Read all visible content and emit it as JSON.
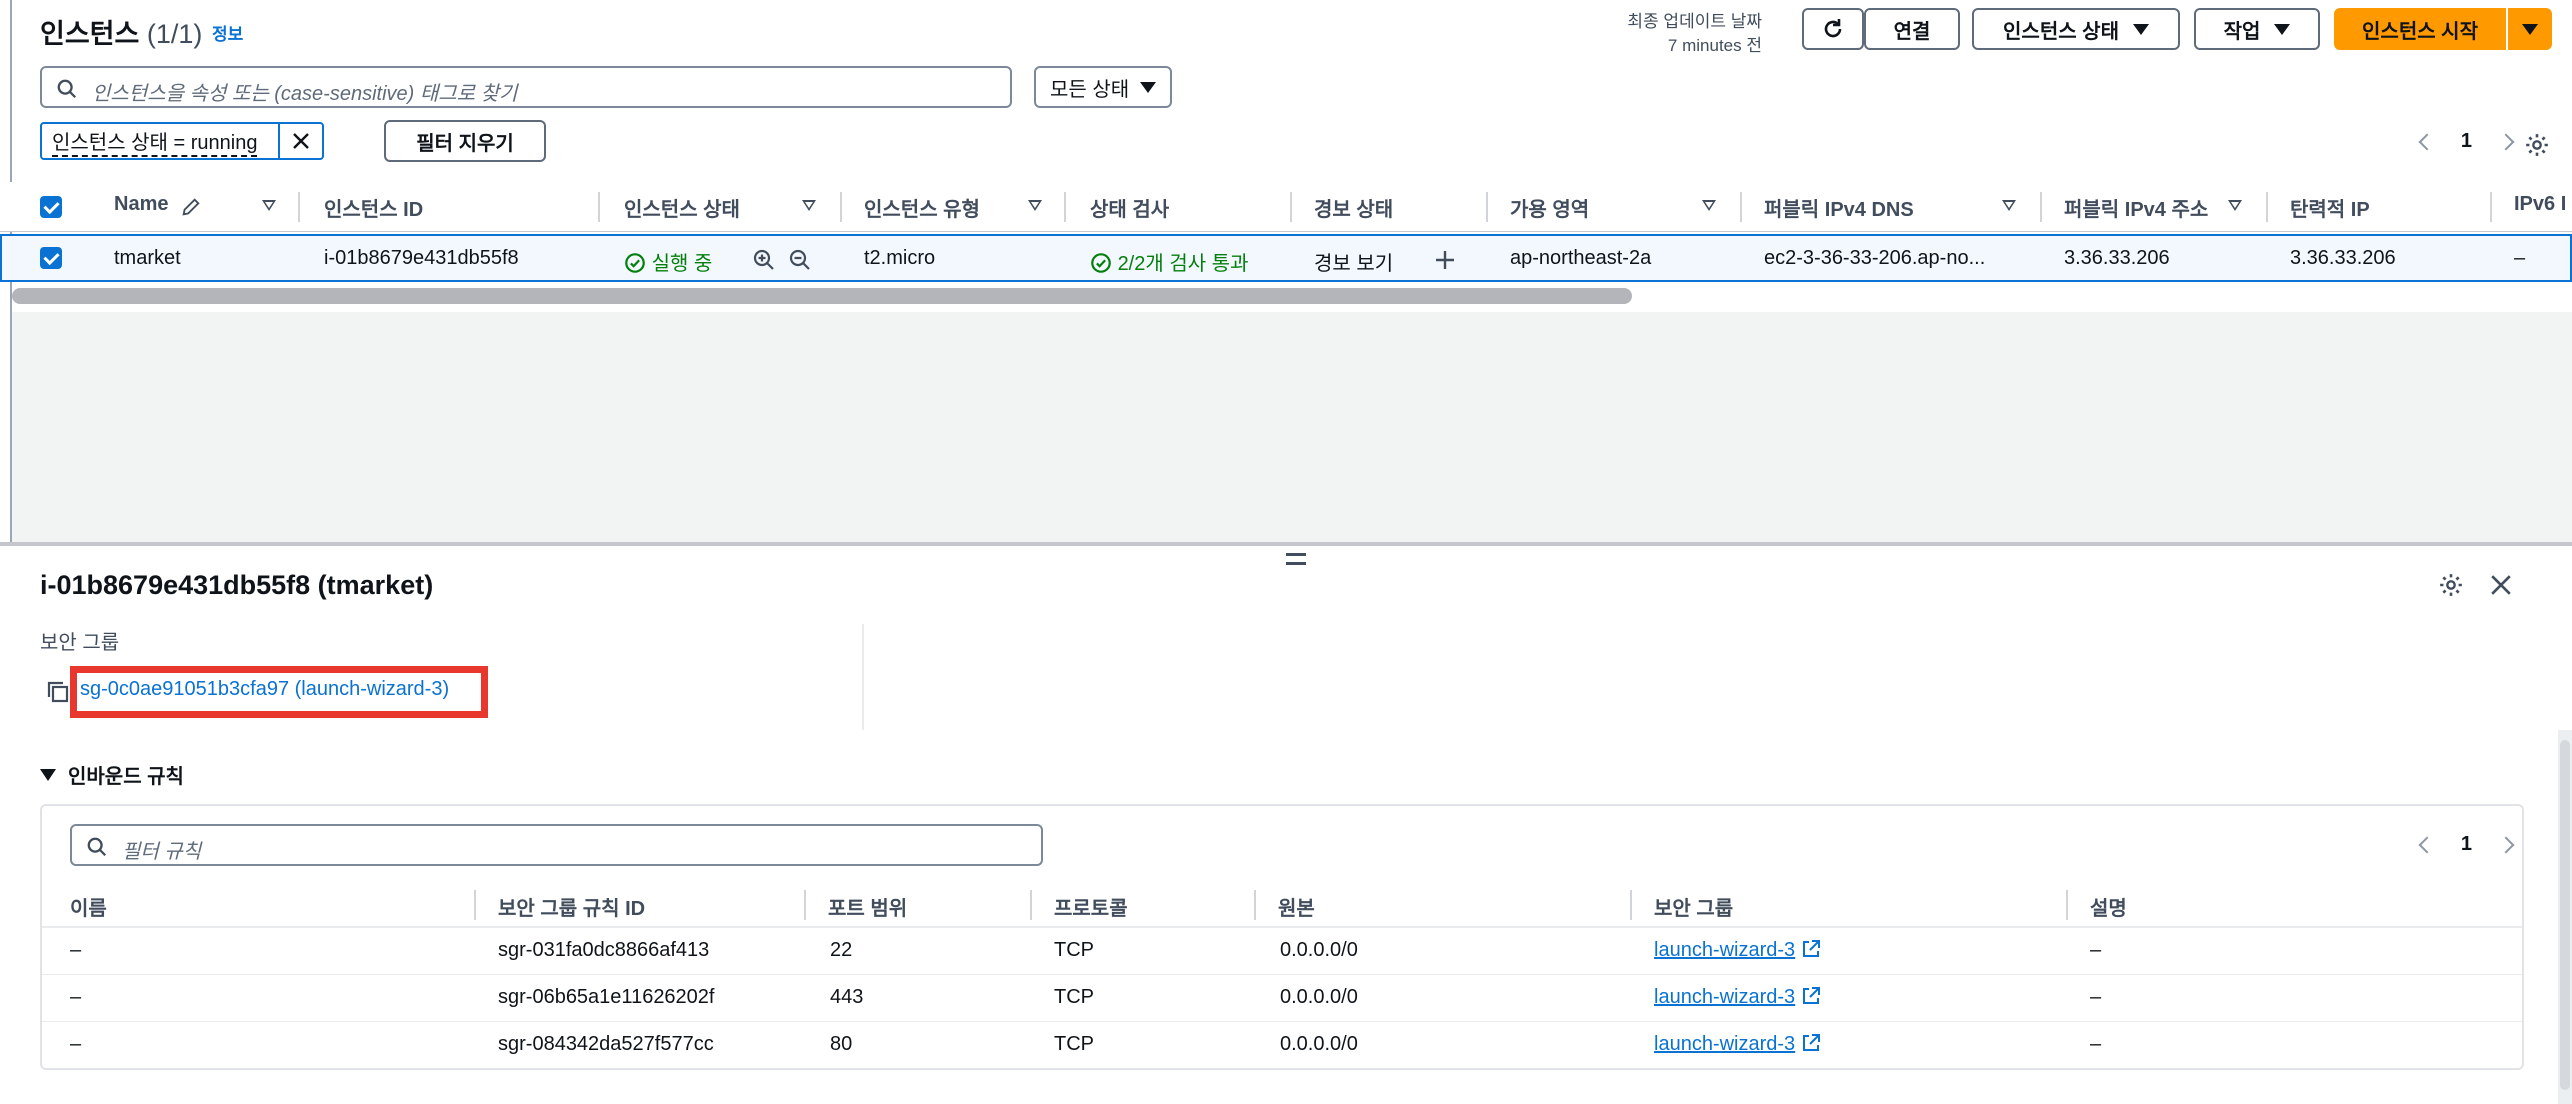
{
  "header": {
    "title": "인스턴스",
    "count": "(1/1)",
    "info": "정보",
    "last_updated_label": "최종 업데이트 날짜",
    "last_updated_value": "7 minutes 전",
    "connect_label": "연결",
    "instance_state_label": "인스턴스 상태",
    "actions_label": "작업",
    "launch_label": "인스턴스 시작"
  },
  "search": {
    "placeholder": "인스턴스을 속성 또는 (case-sensitive) 태그로 찾기",
    "state_filter": "모든 상태"
  },
  "filter": {
    "token": "인스턴스 상태 = running",
    "clear_label": "필터 지우기"
  },
  "pagination": {
    "page": "1"
  },
  "table": {
    "columns": [
      "Name",
      "인스턴스 ID",
      "인스턴스 상태",
      "인스턴스 유형",
      "상태 검사",
      "경보 상태",
      "가용 영역",
      "퍼블릭 IPv4 DNS",
      "퍼블릭 IPv4 주소",
      "탄력적 IP",
      "IPv6 I"
    ],
    "row": {
      "name": "tmarket",
      "instance_id": "i-01b8679e431db55f8",
      "state": "실행 중",
      "type": "t2.micro",
      "status_check": "2/2개 검사 통과",
      "alarm": "경보 보기",
      "az": "ap-northeast-2a",
      "dns": "ec2-3-36-33-206.ap-no...",
      "ipv4": "3.36.33.206",
      "eip": "3.36.33.206",
      "ipv6": "–"
    }
  },
  "details": {
    "title": "i-01b8679e431db55f8 (tmarket)",
    "sg_label": "보안 그룹",
    "sg_link": "sg-0c0ae91051b3cfa97 (launch-wizard-3)",
    "inbound_title": "인바운드 규칙",
    "rules_search_placeholder": "필터 규칙",
    "rules_page": "1",
    "rules_columns": [
      "이름",
      "보안 그룹 규칙 ID",
      "포트 범위",
      "프로토콜",
      "원본",
      "보안 그룹",
      "설명"
    ],
    "rules": [
      {
        "name": "–",
        "id": "sgr-031fa0dc8866af413",
        "port": "22",
        "protocol": "TCP",
        "source": "0.0.0.0/0",
        "sg": "launch-wizard-3",
        "desc": "–"
      },
      {
        "name": "–",
        "id": "sgr-06b65a1e11626202f",
        "port": "443",
        "protocol": "TCP",
        "source": "0.0.0.0/0",
        "sg": "launch-wizard-3",
        "desc": "–"
      },
      {
        "name": "–",
        "id": "sgr-084342da527f577cc",
        "port": "80",
        "protocol": "TCP",
        "source": "0.0.0.0/0",
        "sg": "launch-wizard-3",
        "desc": "–"
      }
    ]
  },
  "colors": {
    "accent": "#0972d3",
    "primary_button": "#ff9900",
    "success": "#037f0c",
    "highlight": "#e8372c"
  }
}
